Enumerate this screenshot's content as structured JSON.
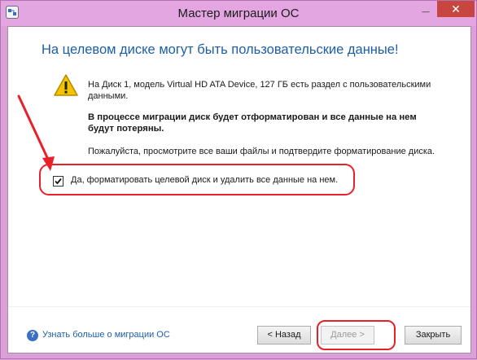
{
  "window": {
    "title": "Мастер миграции ОС",
    "minimize_glyph": "_",
    "close_glyph": "✕"
  },
  "heading": "На целевом диске могут быть пользовательские данные!",
  "messages": {
    "info": "На Диск 1, модель Virtual HD ATA Device, 127 ГБ есть раздел с пользовательскими данными.",
    "warning": "В процессе миграции диск будет отформатирован и все данные на нем будут потеряны.",
    "review": "Пожалуйста, просмотрите все ваши файлы и подтвердите форматирование диска."
  },
  "confirm": {
    "label": "Да, форматировать целевой диск и удалить все данные на нем.",
    "checked": true
  },
  "footer": {
    "help_link": "Узнать больше о миграции ОС",
    "back_label": "< Назад",
    "next_label": "Далее >",
    "close_label": "Закрыть"
  },
  "icons": {
    "app": "migration-app-icon",
    "warning": "warning-triangle-icon",
    "help": "question-circle-icon"
  },
  "colors": {
    "title_bar": "#e3a6e0",
    "heading": "#1c5fa8",
    "annotation": "#e8202a",
    "close_button": "#c7463f"
  }
}
